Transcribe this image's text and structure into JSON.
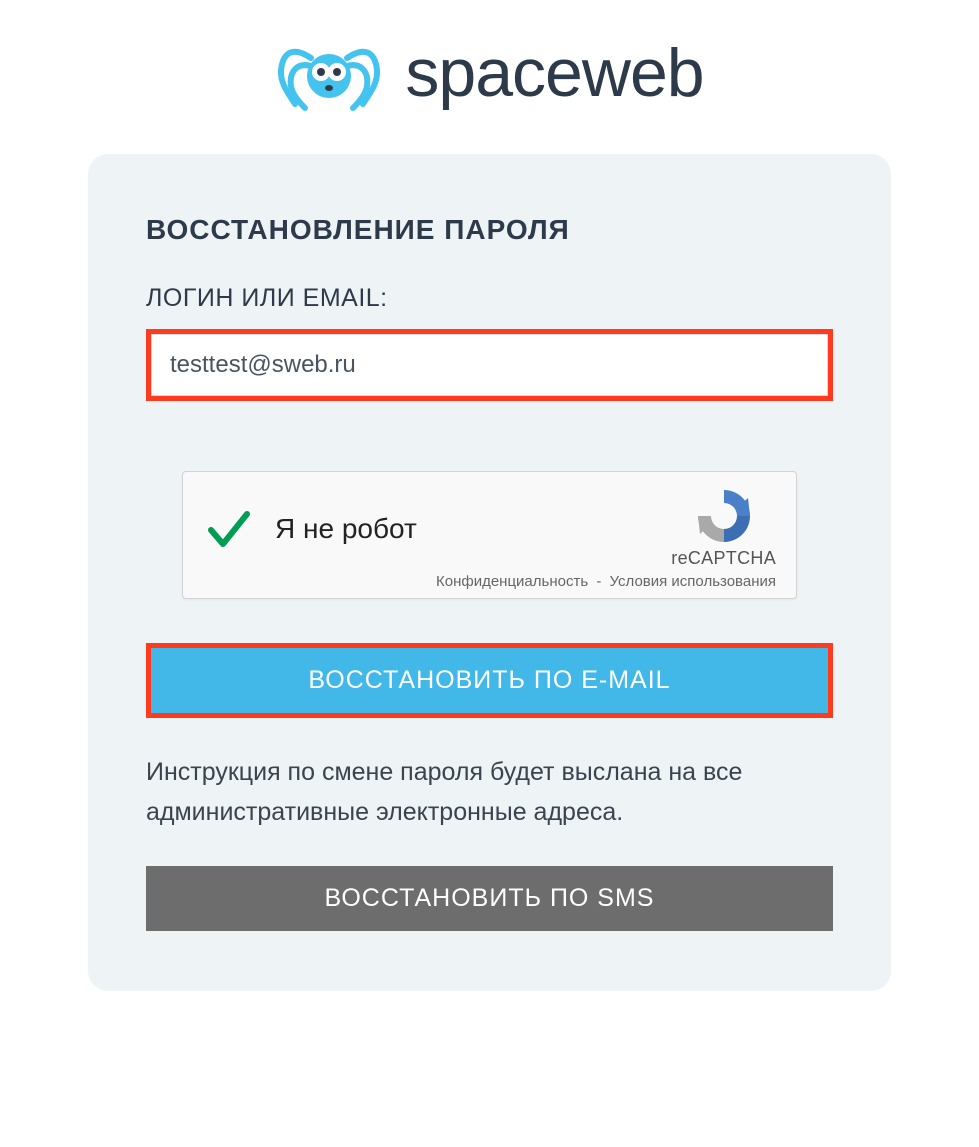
{
  "brand": {
    "name": "spaceweb"
  },
  "form": {
    "title": "ВОССТАНОВЛЕНИЕ ПАРОЛЯ",
    "login_label": "ЛОГИН ИЛИ EMAIL:",
    "login_value": "testtest@sweb.ru",
    "captcha": {
      "label": "Я не робот",
      "brand": "reCAPTCHA",
      "privacy": "Конфиденциальность",
      "terms": "Условия использования",
      "checked": true
    },
    "recover_email_button": "ВОССТАНОВИТЬ ПО E-MAIL",
    "info_text": "Инструкция по смене пароля будет выслана на все административные электронные адреса.",
    "recover_sms_button": "ВОССТАНОВИТЬ ПО SMS"
  },
  "colors": {
    "accent": "#42b8e9",
    "highlight": "#ff3b1f",
    "text_dark": "#2d3a4a",
    "card_bg": "#eef3f6",
    "secondary_btn": "#6d6d6d",
    "logo_blue": "#45c3ef"
  }
}
